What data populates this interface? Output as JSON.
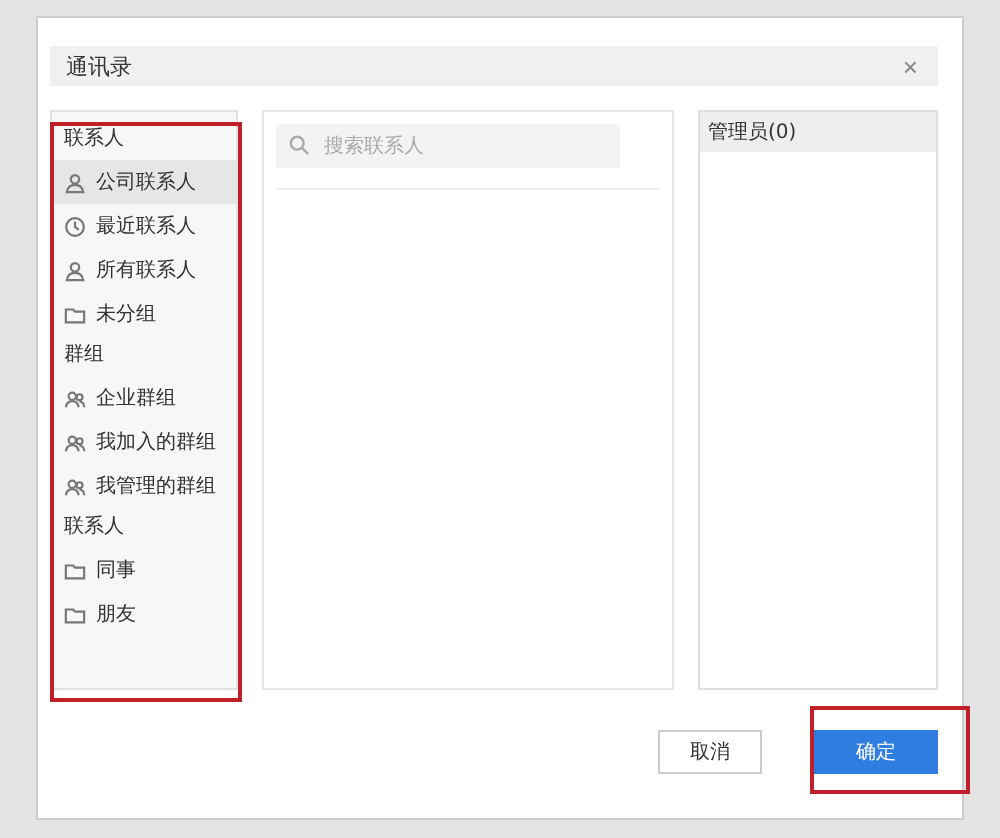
{
  "window": {
    "title": "通讯录",
    "close": "×"
  },
  "sidebar": {
    "groups": [
      {
        "heading": "联系人",
        "items": [
          {
            "label": "公司联系人",
            "kind": "people",
            "selected": true
          },
          {
            "label": "最近联系人",
            "kind": "recent",
            "selected": false
          },
          {
            "label": "所有联系人",
            "kind": "people",
            "selected": false
          },
          {
            "label": "未分组",
            "kind": "folder",
            "selected": false
          }
        ]
      },
      {
        "heading": "群组",
        "items": [
          {
            "label": "企业群组",
            "kind": "group",
            "selected": false
          },
          {
            "label": "我加入的群组",
            "kind": "group",
            "selected": false
          },
          {
            "label": "我管理的群组",
            "kind": "group",
            "selected": false
          }
        ]
      },
      {
        "heading": "联系人",
        "items": [
          {
            "label": "同事",
            "kind": "folder",
            "selected": false
          },
          {
            "label": "朋友",
            "kind": "folder",
            "selected": false
          }
        ]
      }
    ]
  },
  "search": {
    "placeholder": "搜索联系人"
  },
  "members_panel": {
    "heading": "管理员(0)"
  },
  "buttons": [
    {
      "label": "取消",
      "kind": "secondary"
    },
    {
      "label": "确定",
      "kind": "primary"
    }
  ]
}
